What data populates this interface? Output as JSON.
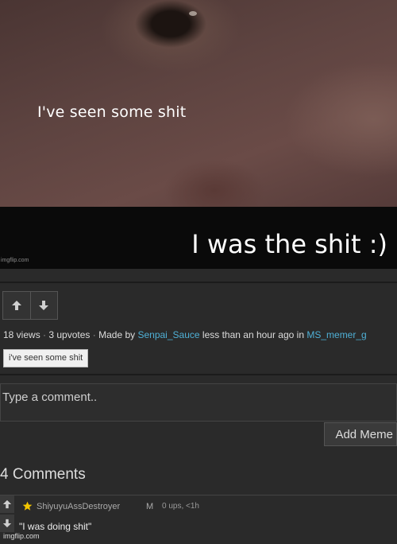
{
  "meme": {
    "top_text": "I've seen some shit",
    "bottom_text": "I was the shit :)",
    "watermark": "imgflip.com"
  },
  "post": {
    "views": "18 views",
    "upvotes": "3 upvotes",
    "made_by_label": "Made by",
    "author": "Senpai_Sauce",
    "time": "less than an hour ago in",
    "stream": "MS_memer_g",
    "tag": "i've seen some shit"
  },
  "comment_input": {
    "placeholder": "Type a comment.."
  },
  "add_meme_label": "Add Meme",
  "comments_header": "4 Comments",
  "comments": [
    {
      "user": "ShiyuyuAssDestroyer",
      "flag": "M",
      "info": "0 ups, <1h",
      "text": "\"I was doing shit\""
    }
  ],
  "footer_mark": "imgflip.com",
  "colors": {
    "link": "#4fb0d6",
    "star": "#f2c500",
    "background": "#2a2a2a"
  },
  "icons": {
    "vote_up": "arrow-up-icon",
    "vote_down": "arrow-down-icon",
    "star": "star-icon"
  }
}
